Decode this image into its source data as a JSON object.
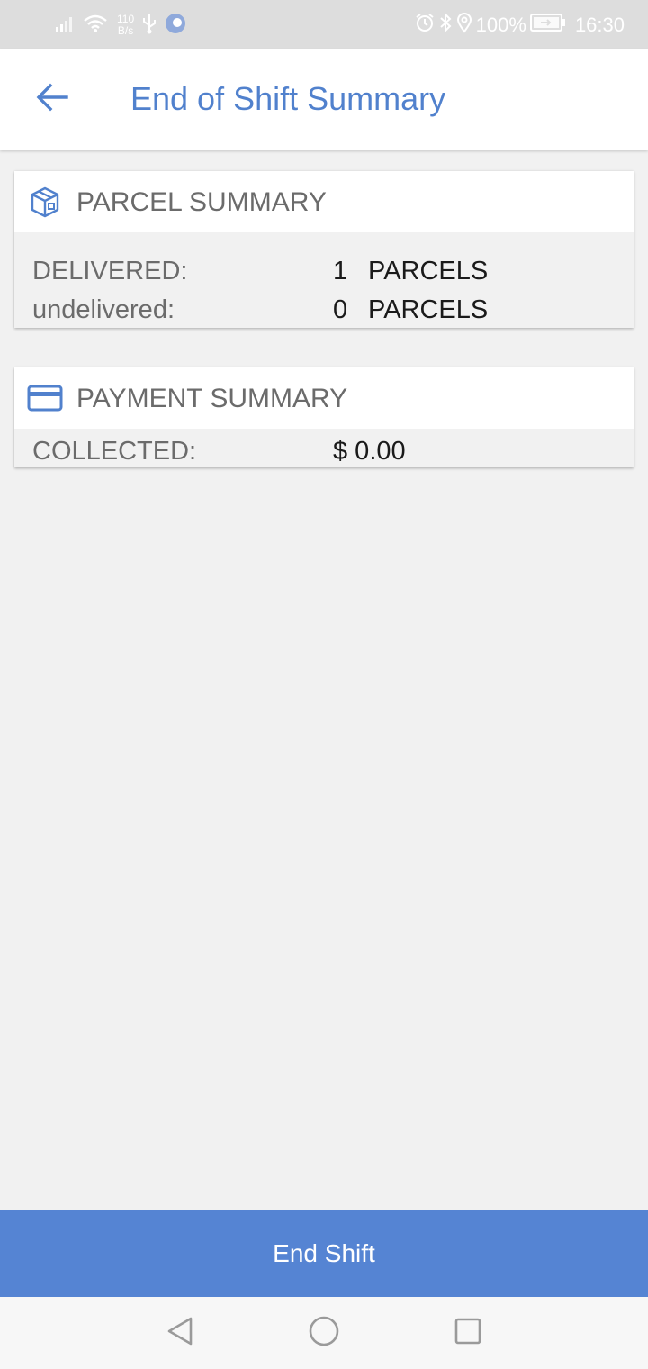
{
  "status_bar": {
    "net_speed_value": "110",
    "net_speed_unit": "B/s",
    "battery_percent": "100%",
    "time": "16:30"
  },
  "app_bar": {
    "title": "End of Shift Summary"
  },
  "parcel_summary": {
    "title": "PARCEL SUMMARY",
    "rows": [
      {
        "label": "DELIVERED:",
        "value": "1",
        "unit": "PARCELS"
      },
      {
        "label": "undelivered:",
        "value": "0",
        "unit": "PARCELS"
      }
    ]
  },
  "payment_summary": {
    "title": "PAYMENT SUMMARY",
    "rows": [
      {
        "label": "COLLECTED:",
        "value": "$ 0.00"
      }
    ]
  },
  "footer": {
    "end_shift_label": "End Shift"
  },
  "colors": {
    "accent": "#5181cd",
    "button": "#5584d3",
    "background": "#f1f1f1",
    "status_bar": "#dddddd"
  },
  "icons": {
    "back": "arrow-left-icon",
    "parcel": "package-icon",
    "payment": "credit-card-icon"
  }
}
